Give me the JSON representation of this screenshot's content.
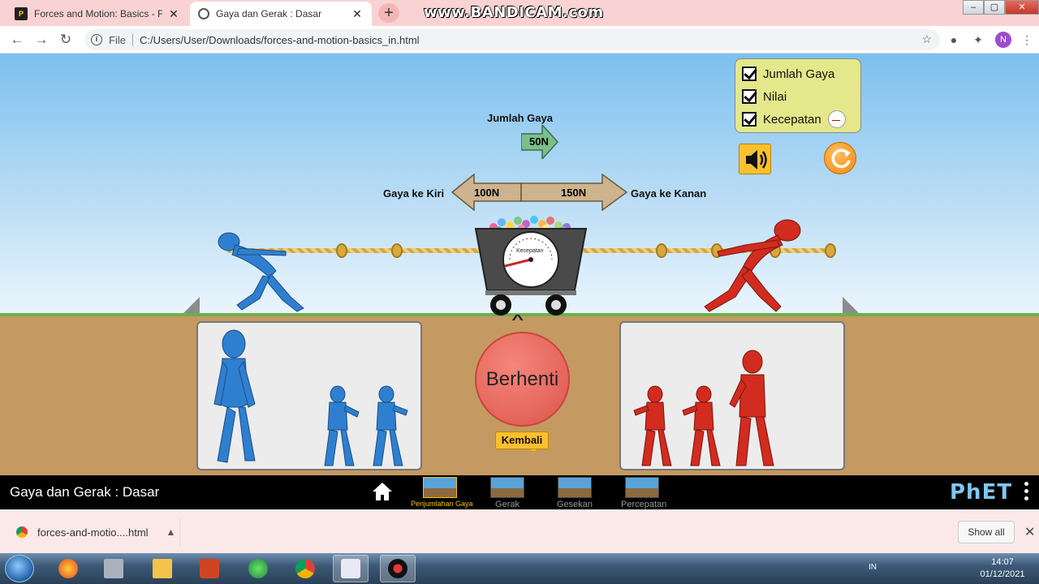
{
  "browser": {
    "tabs": [
      {
        "title": "Forces and Motion: Basics - Force",
        "active": false
      },
      {
        "title": "Gaya dan Gerak : Dasar",
        "active": true
      }
    ],
    "new_tab_symbol": "+",
    "watermark": "www.BANDICAM.com",
    "address_scheme": "File",
    "url": "C:/Users/User/Downloads/forces-and-motion-basics_in.html",
    "profile_initial": "N"
  },
  "sim": {
    "sum_of_forces_label": "Jumlah Gaya",
    "sum_of_forces_value": "50N",
    "left_force_label": "Gaya ke Kiri",
    "left_force_value": "100N",
    "right_force_label": "Gaya ke Kanan",
    "right_force_value": "150N",
    "speedometer_label": "Kecepatan",
    "go_button_label": "Berhenti",
    "return_button_label": "Kembali",
    "control_panel": [
      {
        "label": "Jumlah Gaya",
        "checked": true
      },
      {
        "label": "Nilai",
        "checked": true
      },
      {
        "label": "Kecepatan",
        "checked": true
      }
    ],
    "left_team_color": "#2f7fd0",
    "right_team_color": "#d22b1f"
  },
  "navbar": {
    "title": "Gaya dan Gerak : Dasar",
    "screens": [
      {
        "label": "Penjumlahan Gaya",
        "active": true
      },
      {
        "label": "Gerak",
        "active": false
      },
      {
        "label": "Gesekan",
        "active": false
      },
      {
        "label": "Percepatan",
        "active": false
      }
    ],
    "logo": "PhET"
  },
  "downloads": {
    "file_name": "forces-and-motio....html",
    "show_all_label": "Show all"
  },
  "taskbar": {
    "language": "IN",
    "time": "14:07",
    "date": "01/12/2021"
  }
}
